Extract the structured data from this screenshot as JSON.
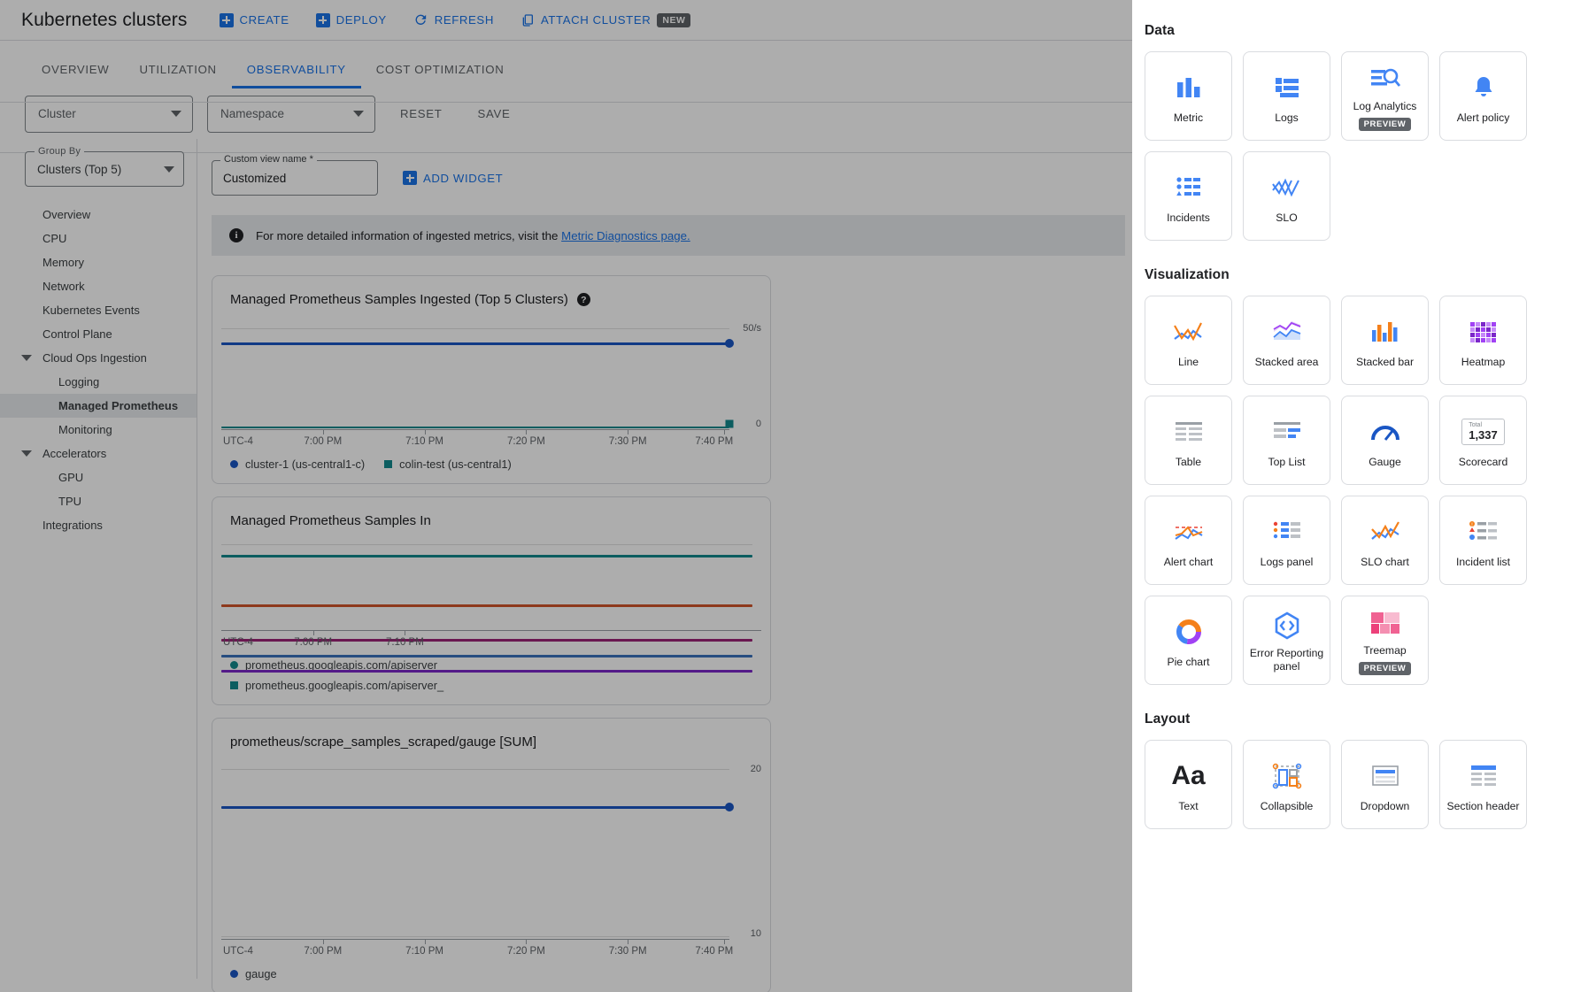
{
  "header": {
    "title": "Kubernetes clusters",
    "actions": [
      {
        "label": "CREATE",
        "icon": "plus-square-icon"
      },
      {
        "label": "DEPLOY",
        "icon": "plus-square-icon"
      },
      {
        "label": "REFRESH",
        "icon": "refresh-icon"
      },
      {
        "label": "ATTACH CLUSTER",
        "icon": "copy-icon",
        "badge": "NEW"
      }
    ]
  },
  "tabs": [
    {
      "label": "OVERVIEW",
      "active": false
    },
    {
      "label": "UTILIZATION",
      "active": false
    },
    {
      "label": "OBSERVABILITY",
      "active": true
    },
    {
      "label": "COST OPTIMIZATION",
      "active": false
    }
  ],
  "filters": {
    "cluster_select": "Cluster",
    "namespace_select": "Namespace",
    "reset_label": "RESET",
    "save_label": "SAVE"
  },
  "sidebar": {
    "group_by": {
      "label": "Group By",
      "value": "Clusters (Top 5)"
    },
    "items": [
      {
        "label": "Overview",
        "level": 1,
        "expandable": false,
        "selected": false
      },
      {
        "label": "CPU",
        "level": 1,
        "expandable": false,
        "selected": false
      },
      {
        "label": "Memory",
        "level": 1,
        "expandable": false,
        "selected": false
      },
      {
        "label": "Network",
        "level": 1,
        "expandable": false,
        "selected": false
      },
      {
        "label": "Kubernetes Events",
        "level": 1,
        "expandable": false,
        "selected": false
      },
      {
        "label": "Control Plane",
        "level": 1,
        "expandable": false,
        "selected": false
      },
      {
        "label": "Cloud Ops Ingestion",
        "level": 1,
        "expandable": true,
        "selected": false
      },
      {
        "label": "Logging",
        "level": 2,
        "expandable": false,
        "selected": false
      },
      {
        "label": "Managed Prometheus",
        "level": 2,
        "expandable": false,
        "selected": true
      },
      {
        "label": "Monitoring",
        "level": 2,
        "expandable": false,
        "selected": false
      },
      {
        "label": "Accelerators",
        "level": 1,
        "expandable": true,
        "selected": false
      },
      {
        "label": "GPU",
        "level": 2,
        "expandable": false,
        "selected": false
      },
      {
        "label": "TPU",
        "level": 2,
        "expandable": false,
        "selected": false
      },
      {
        "label": "Integrations",
        "level": 1,
        "expandable": false,
        "selected": false
      }
    ]
  },
  "main": {
    "custom_view": {
      "label": "Custom view name *",
      "value": "Customized"
    },
    "add_widget_label": "ADD WIDGET",
    "info_banner": {
      "text": "For more detailed information of ingested metrics, visit the ",
      "link_text": "Metric Diagnostics page."
    }
  },
  "chart_data": [
    {
      "type": "line",
      "title": "Managed Prometheus Samples Ingested (Top 5 Clusters)",
      "xlabel": "UTC-4",
      "ylabel": "",
      "ylim": [
        0,
        50
      ],
      "ytick_labels": [
        "50/s",
        "0"
      ],
      "xtick_labels": [
        "7:00 PM",
        "7:10 PM",
        "7:20 PM",
        "7:30 PM",
        "7:40 PM"
      ],
      "grid": true,
      "legend_position": "bottom",
      "series": [
        {
          "name": "cluster-1 (us-central1-c)",
          "color": "#1a56c4",
          "marker": "circle",
          "value": 43
        },
        {
          "name": "colin-test (us-central1)",
          "color": "#12898e",
          "marker": "square",
          "value": 0.3
        }
      ]
    },
    {
      "type": "line",
      "title": "Managed Prometheus Samples In",
      "xlabel": "UTC-4",
      "ylabel": "",
      "xtick_labels": [
        "7:00 PM",
        "7:10 PM"
      ],
      "grid": true,
      "legend_position": "bottom",
      "series": [
        {
          "name": "prometheus.googleapis.com/apiserver_",
          "color": "#12898e",
          "value": 88
        },
        {
          "name": "prometheus.googleapis.com/apiserver_",
          "color": "#d2542a",
          "value": 48
        },
        {
          "name": "",
          "color": "#9c2277",
          "value": 24
        },
        {
          "name": "",
          "color": "#3a72bd",
          "value": 16
        },
        {
          "name": "",
          "color": "#7b27c9",
          "value": 9
        }
      ]
    },
    {
      "type": "line",
      "title": "prometheus/scrape_samples_scraped/gauge [SUM]",
      "xlabel": "UTC-4",
      "ylabel": "",
      "ylim": [
        10,
        20
      ],
      "ytick_labels": [
        "20",
        "10"
      ],
      "xtick_labels": [
        "7:00 PM",
        "7:10 PM",
        "7:20 PM",
        "7:30 PM",
        "7:40 PM"
      ],
      "grid": true,
      "legend_position": "bottom",
      "series": [
        {
          "name": "gauge",
          "color": "#1a56c4",
          "marker": "circle",
          "value": 18
        }
      ]
    }
  ],
  "picker": {
    "sections": [
      {
        "title": "Data",
        "items": [
          {
            "label": "Metric",
            "icon": "bar-chart-icon",
            "badge": null
          },
          {
            "label": "Logs",
            "icon": "logs-icon",
            "badge": null
          },
          {
            "label": "Log Analytics",
            "icon": "log-analytics-icon",
            "badge": "PREVIEW"
          },
          {
            "label": "Alert policy",
            "icon": "bell-icon",
            "badge": null
          },
          {
            "label": "Incidents",
            "icon": "incidents-list-icon",
            "badge": null
          },
          {
            "label": "SLO",
            "icon": "slo-zigzag-icon",
            "badge": null
          }
        ]
      },
      {
        "title": "Visualization",
        "items": [
          {
            "label": "Line",
            "icon": "line-chart-icon",
            "badge": null
          },
          {
            "label": "Stacked area",
            "icon": "stacked-area-icon",
            "badge": null
          },
          {
            "label": "Stacked bar",
            "icon": "stacked-bar-icon",
            "badge": null
          },
          {
            "label": "Heatmap",
            "icon": "heatmap-icon",
            "badge": null
          },
          {
            "label": "Table",
            "icon": "table-icon",
            "badge": null
          },
          {
            "label": "Top List",
            "icon": "top-list-icon",
            "badge": null
          },
          {
            "label": "Gauge",
            "icon": "gauge-icon",
            "badge": null
          },
          {
            "label": "Scorecard",
            "icon": "scorecard-icon",
            "badge": null,
            "sub": "Total",
            "value": "1,337"
          },
          {
            "label": "Alert chart",
            "icon": "alert-chart-icon",
            "badge": null
          },
          {
            "label": "Logs panel",
            "icon": "logs-panel-icon",
            "badge": null
          },
          {
            "label": "SLO chart",
            "icon": "slo-chart-icon",
            "badge": null
          },
          {
            "label": "Incident list",
            "icon": "incident-list-icon",
            "badge": null
          },
          {
            "label": "Pie chart",
            "icon": "pie-chart-icon",
            "badge": null
          },
          {
            "label": "Error Reporting panel",
            "icon": "error-reporting-icon",
            "badge": null
          },
          {
            "label": "Treemap",
            "icon": "treemap-icon",
            "badge": "PREVIEW"
          }
        ]
      },
      {
        "title": "Layout",
        "items": [
          {
            "label": "Text",
            "icon": "text-aa-icon",
            "badge": null
          },
          {
            "label": "Collapsible",
            "icon": "collapsible-icon",
            "badge": null
          },
          {
            "label": "Dropdown",
            "icon": "dropdown-icon",
            "badge": null
          },
          {
            "label": "Section header",
            "icon": "section-header-icon",
            "badge": null
          }
        ]
      }
    ]
  },
  "colors": {
    "accent": "#1a73e8",
    "series_blue": "#1a56c4",
    "series_teal": "#12898e",
    "series_orange": "#d2542a",
    "series_magenta": "#9c2277",
    "series_purple": "#7b27c9"
  }
}
